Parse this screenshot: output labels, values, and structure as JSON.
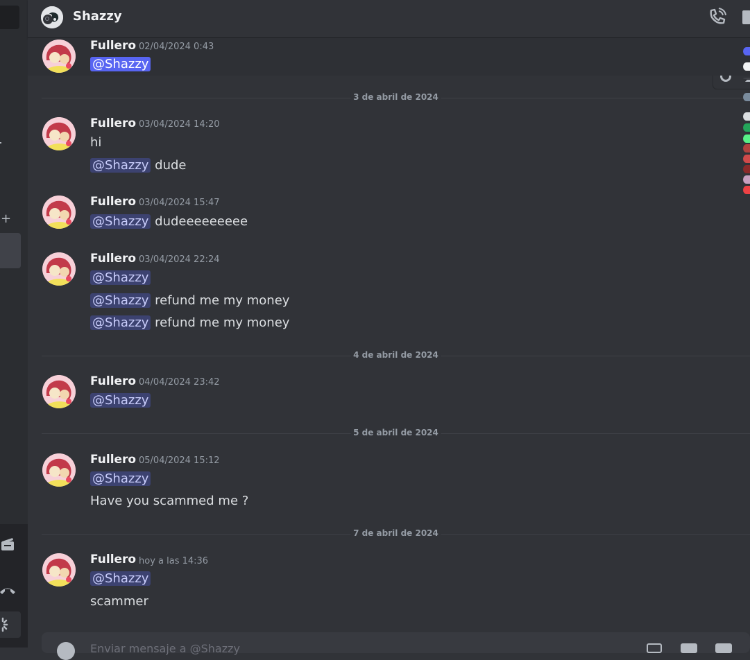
{
  "header": {
    "title": "Shazzy"
  },
  "user": {
    "name": "Fullero"
  },
  "messages": [
    {
      "time": "02/04/2024 0:43",
      "lines": [
        {
          "mention": "@Shazzy",
          "text": ""
        }
      ]
    },
    {
      "time": "03/04/2024 14:20",
      "lines": [
        {
          "mention": "",
          "text": "hi"
        },
        {
          "mention": "@Shazzy",
          "text": " dude"
        }
      ]
    },
    {
      "time": "03/04/2024 15:47",
      "lines": [
        {
          "mention": "@Shazzy",
          "text": " dudeeeeeeeee"
        }
      ]
    },
    {
      "time": "03/04/2024 22:24",
      "lines": [
        {
          "mention": "@Shazzy",
          "text": ""
        },
        {
          "mention": "@Shazzy",
          "text": " refund me my money"
        },
        {
          "mention": "@Shazzy",
          "text": " refund me my money"
        }
      ]
    },
    {
      "time": "04/04/2024 23:42",
      "lines": [
        {
          "mention": "@Shazzy",
          "text": ""
        }
      ]
    },
    {
      "time": "05/04/2024 15:12",
      "lines": [
        {
          "mention": "@Shazzy",
          "text": ""
        },
        {
          "mention": "",
          "text": "Have you scammed me ?"
        }
      ]
    },
    {
      "time": "hoy a las 14:36",
      "lines": [
        {
          "mention": "@Shazzy",
          "text": ""
        },
        {
          "mention": "",
          "text": "scammer"
        }
      ]
    }
  ],
  "dividers": [
    "3 de abril de 2024",
    "4 de abril de 2024",
    "5 de abril de 2024",
    "7 de abril de 2024"
  ],
  "composer": {
    "placeholder": "Enviar mensaje a @Shazzy"
  },
  "icons": {
    "header": [
      "avatar",
      "offline-status-icon",
      "phone-call-icon",
      "video-icon"
    ],
    "sidebar": [
      "plus-icon",
      "film-icon",
      "phone-hangup-icon",
      "loading-icon"
    ],
    "composer": [
      "add-attachment-icon",
      "gift-icon",
      "gif-icon",
      "sticker-icon"
    ]
  },
  "colors": {
    "background": "#313338",
    "mention_bg": "#3c4270",
    "mention_text": "#c9cdfb",
    "accent": "#5865f2"
  }
}
